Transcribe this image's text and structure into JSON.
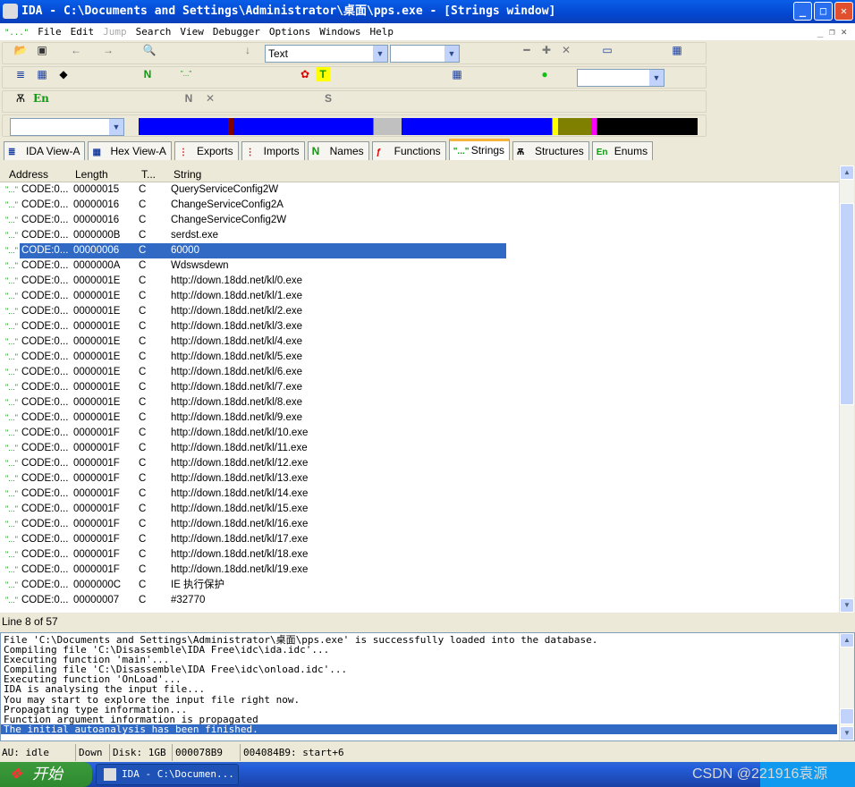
{
  "window": {
    "title": "IDA - C:\\Documents and Settings\\Administrator\\桌面\\pps.exe - [Strings window]"
  },
  "menu": [
    "File",
    "Edit",
    "Jump",
    "Search",
    "View",
    "Debugger",
    "Options",
    "Windows",
    "Help"
  ],
  "toolbar": {
    "search_type": "Text"
  },
  "tabs": [
    {
      "label": "IDA View-A"
    },
    {
      "label": "Hex View-A"
    },
    {
      "label": "Exports"
    },
    {
      "label": "Imports"
    },
    {
      "label": "Names"
    },
    {
      "label": "Functions"
    },
    {
      "label": "Strings",
      "active": true
    },
    {
      "label": "Structures"
    },
    {
      "label": "Enums"
    }
  ],
  "strings": {
    "columns": [
      "Address",
      "Length",
      "T...",
      "String"
    ],
    "selected_index": 4,
    "rows": [
      [
        "CODE:0...",
        "00000015",
        "C",
        "QueryServiceConfig2W"
      ],
      [
        "CODE:0...",
        "00000016",
        "C",
        "ChangeServiceConfig2A"
      ],
      [
        "CODE:0...",
        "00000016",
        "C",
        "ChangeServiceConfig2W"
      ],
      [
        "CODE:0...",
        "0000000B",
        "C",
        "serdst.exe"
      ],
      [
        "CODE:0...",
        "00000006",
        "C",
        "60000"
      ],
      [
        "CODE:0...",
        "0000000A",
        "C",
        "Wdswsdewn"
      ],
      [
        "CODE:0...",
        "0000001E",
        "C",
        "http://down.18dd.net/kl/0.exe"
      ],
      [
        "CODE:0...",
        "0000001E",
        "C",
        "http://down.18dd.net/kl/1.exe"
      ],
      [
        "CODE:0...",
        "0000001E",
        "C",
        "http://down.18dd.net/kl/2.exe"
      ],
      [
        "CODE:0...",
        "0000001E",
        "C",
        "http://down.18dd.net/kl/3.exe"
      ],
      [
        "CODE:0...",
        "0000001E",
        "C",
        "http://down.18dd.net/kl/4.exe"
      ],
      [
        "CODE:0...",
        "0000001E",
        "C",
        "http://down.18dd.net/kl/5.exe"
      ],
      [
        "CODE:0...",
        "0000001E",
        "C",
        "http://down.18dd.net/kl/6.exe"
      ],
      [
        "CODE:0...",
        "0000001E",
        "C",
        "http://down.18dd.net/kl/7.exe"
      ],
      [
        "CODE:0...",
        "0000001E",
        "C",
        "http://down.18dd.net/kl/8.exe"
      ],
      [
        "CODE:0...",
        "0000001E",
        "C",
        "http://down.18dd.net/kl/9.exe"
      ],
      [
        "CODE:0...",
        "0000001F",
        "C",
        "http://down.18dd.net/kl/10.exe"
      ],
      [
        "CODE:0...",
        "0000001F",
        "C",
        "http://down.18dd.net/kl/11.exe"
      ],
      [
        "CODE:0...",
        "0000001F",
        "C",
        "http://down.18dd.net/kl/12.exe"
      ],
      [
        "CODE:0...",
        "0000001F",
        "C",
        "http://down.18dd.net/kl/13.exe"
      ],
      [
        "CODE:0...",
        "0000001F",
        "C",
        "http://down.18dd.net/kl/14.exe"
      ],
      [
        "CODE:0...",
        "0000001F",
        "C",
        "http://down.18dd.net/kl/15.exe"
      ],
      [
        "CODE:0...",
        "0000001F",
        "C",
        "http://down.18dd.net/kl/16.exe"
      ],
      [
        "CODE:0...",
        "0000001F",
        "C",
        "http://down.18dd.net/kl/17.exe"
      ],
      [
        "CODE:0...",
        "0000001F",
        "C",
        "http://down.18dd.net/kl/18.exe"
      ],
      [
        "CODE:0...",
        "0000001F",
        "C",
        "http://down.18dd.net/kl/19.exe"
      ],
      [
        "CODE:0...",
        "0000000C",
        "C",
        "IE 执行保护"
      ],
      [
        "CODE:0...",
        "00000007",
        "C",
        "#32770"
      ]
    ],
    "line_info": "Line 8 of 57"
  },
  "output": [
    "File 'C:\\Documents and Settings\\Administrator\\桌面\\pps.exe' is successfully loaded into the database.",
    "Compiling file 'C:\\Disassemble\\IDA Free\\idc\\ida.idc'...",
    "Executing function 'main'...",
    "Compiling file 'C:\\Disassemble\\IDA Free\\idc\\onload.idc'...",
    "Executing function 'OnLoad'...",
    "IDA is analysing the input file...",
    "You may start to explore the input file right now.",
    "Propagating type information...",
    "Function argument information is propagated",
    "The initial autoanalysis has been finished."
  ],
  "status": {
    "au": "AU:  idle",
    "direction": "Down",
    "disk": "Disk: 1GB",
    "offset": "000078B9",
    "location": "004084B9: start+6"
  },
  "taskbar": {
    "start": "开始",
    "task": "IDA - C:\\Documen...",
    "watermark": "CSDN @221916袁源"
  },
  "colors": {
    "title_bar": "#0347d0",
    "selection": "#316ac5",
    "nav_code": "#0000ff",
    "nav_data": "#800000"
  }
}
